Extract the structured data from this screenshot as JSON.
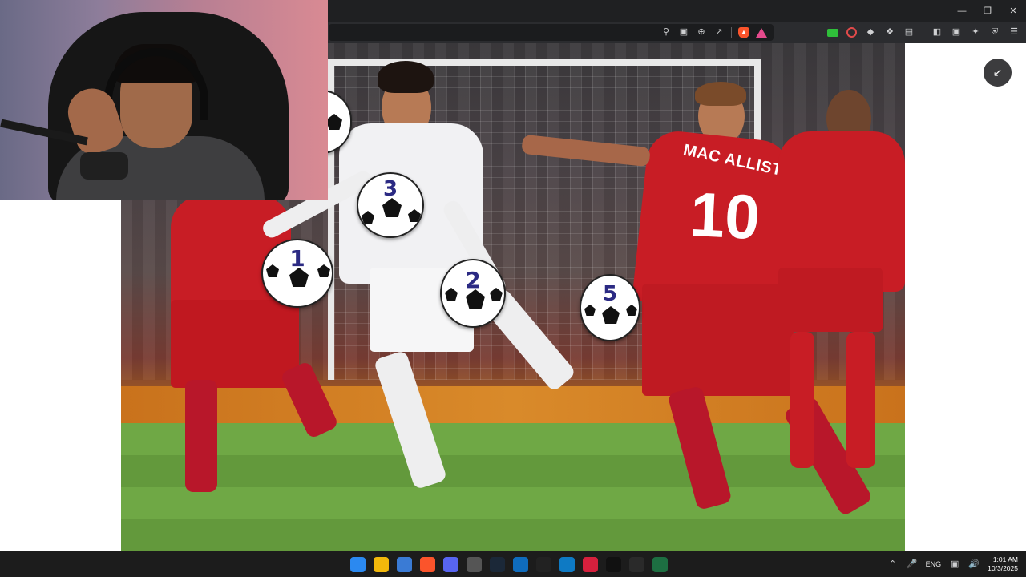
{
  "window": {
    "controls": {
      "minimize_icon": "minimize-icon",
      "restore_icon": "restore-icon",
      "close_icon": "close-icon"
    }
  },
  "toolbar": {
    "url_icons": [
      "key-icon",
      "cast-icon",
      "zoom-icon",
      "share-icon",
      "brave-shield-icon",
      "brave-rewards-icon"
    ],
    "extension_icons": [
      "green-extension-icon",
      "record-extension-icon",
      "diamond-extension-icon",
      "puzzle-icon",
      "reading-list-icon",
      "sidebar-icon",
      "wallet-icon",
      "leo-ai-icon",
      "vpn-icon",
      "menu-icon"
    ]
  },
  "image": {
    "shirt_name": "MAC ALLISTER",
    "shirt_number": "10",
    "balls": [
      {
        "label": "1"
      },
      {
        "label": "2"
      },
      {
        "label": "3"
      },
      {
        "label": "5"
      },
      {
        "label": ""
      }
    ]
  },
  "overlay": {
    "collapse_icon": "collapse-icon"
  },
  "taskbar": {
    "apps": [
      {
        "name": "windows-start-icon",
        "color": "#2b89f0"
      },
      {
        "name": "file-explorer-icon",
        "color": "#f2b80b"
      },
      {
        "name": "store-icon",
        "color": "#3a7bd5"
      },
      {
        "name": "brave-icon",
        "color": "#fb542b"
      },
      {
        "name": "discord-icon",
        "color": "#5865f2"
      },
      {
        "name": "clock-app-icon",
        "color": "#555555"
      },
      {
        "name": "steam-icon",
        "color": "#1b2838"
      },
      {
        "name": "outlook-icon",
        "color": "#0f6cbd"
      },
      {
        "name": "capture-app-icon",
        "color": "#222222"
      },
      {
        "name": "task-app-icon",
        "color": "#0e7ac4"
      },
      {
        "name": "red-app-icon",
        "color": "#d6203d"
      },
      {
        "name": "tiktok-icon",
        "color": "#111111"
      },
      {
        "name": "obs-icon",
        "color": "#2a2a2a"
      },
      {
        "name": "sheets-app-icon",
        "color": "#1d6f42"
      }
    ],
    "tray": {
      "language": "ENG",
      "time": "1:01 AM",
      "date": "10/3/2025"
    }
  }
}
